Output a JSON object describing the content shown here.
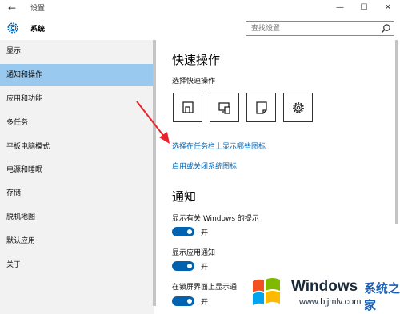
{
  "window": {
    "title": "设置",
    "back_icon": "←",
    "minimize_icon": "—",
    "maximize_icon": "☐",
    "close_icon": "✕"
  },
  "header": {
    "title": "系统",
    "search_placeholder": "查找设置"
  },
  "sidebar": {
    "items": [
      {
        "label": "显示",
        "active": false
      },
      {
        "label": "通知和操作",
        "active": true
      },
      {
        "label": "应用和功能",
        "active": false
      },
      {
        "label": "多任务",
        "active": false
      },
      {
        "label": "平板电脑模式",
        "active": false
      },
      {
        "label": "电源和睡眠",
        "active": false
      },
      {
        "label": "存储",
        "active": false
      },
      {
        "label": "脱机地图",
        "active": false
      },
      {
        "label": "默认应用",
        "active": false
      },
      {
        "label": "关于",
        "active": false
      }
    ]
  },
  "main": {
    "quick_actions_title": "快速操作",
    "quick_actions_subtitle": "选择快速操作",
    "quick_actions": [
      {
        "icon": "tablet-mode-icon"
      },
      {
        "icon": "connect-icon"
      },
      {
        "icon": "note-icon"
      },
      {
        "icon": "settings-gear-icon"
      }
    ],
    "link_taskbar_icons": "选择在任务栏上显示哪些图标",
    "link_system_icons": "启用或关闭系统图标",
    "notifications_title": "通知",
    "settings": [
      {
        "label": "显示有关 Windows 的提示",
        "state": "开",
        "on": true
      },
      {
        "label": "显示应用通知",
        "state": "开",
        "on": true
      },
      {
        "label": "在锁屏界面上显示通",
        "state": "开",
        "on": true
      }
    ]
  },
  "watermark": {
    "brand": "Windows",
    "cn": "系统之家",
    "url": "www.bjjmlv.com"
  },
  "colors": {
    "accent": "#0063b1",
    "sidebar_bg": "#f2f2f2",
    "sidebar_active": "#99c9ef",
    "annotation_arrow": "#e8232b"
  }
}
